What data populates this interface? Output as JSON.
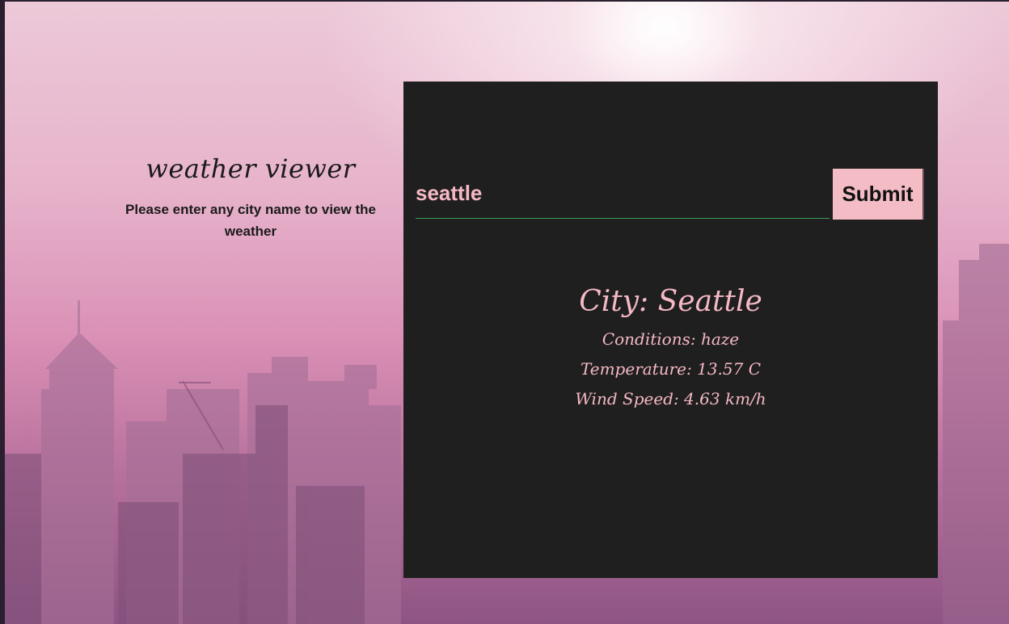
{
  "app": {
    "title": "weather viewer",
    "subtitle": "Please enter any city name to view the weather"
  },
  "search": {
    "value": "seattle",
    "submit_label": "Submit"
  },
  "result": {
    "city": "City: Seattle",
    "conditions": "Conditions: haze",
    "temperature": "Temperature: 13.57 C",
    "wind": "Wind Speed: 4.63 km/h"
  },
  "colors": {
    "card_bg": "#1f1f1f",
    "accent_pink": "#f5b9c4",
    "button_bg": "#f4bcc5",
    "input_underline": "#3f9a58"
  }
}
